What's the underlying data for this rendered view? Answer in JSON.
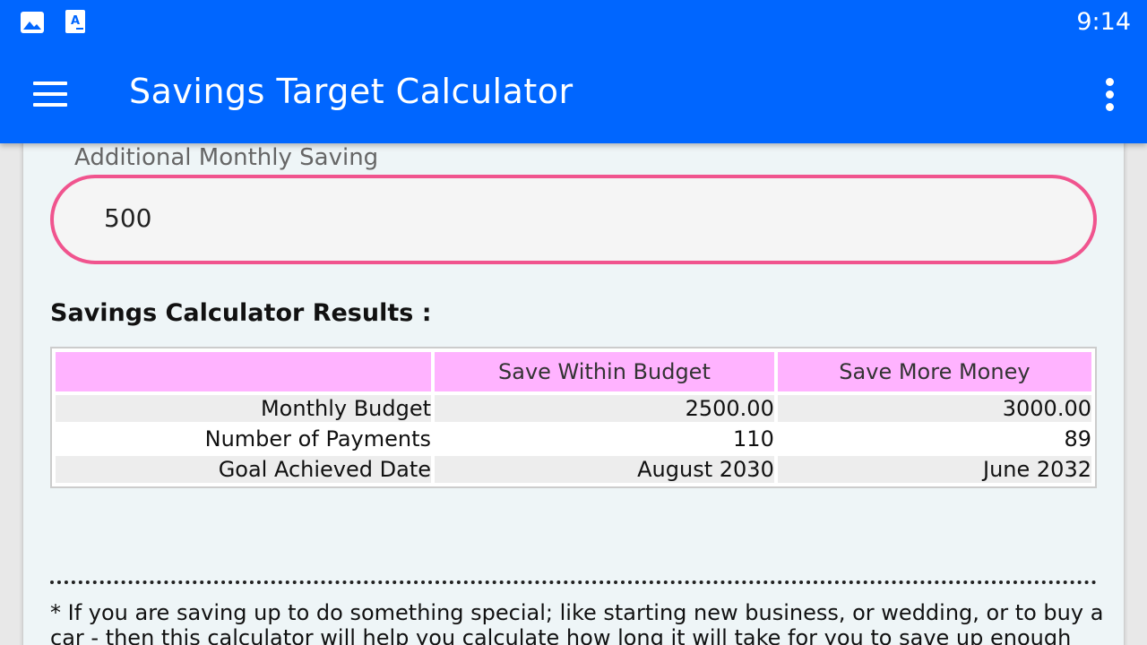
{
  "status_bar": {
    "time": "9:14",
    "icons": [
      "image-icon",
      "app-store-icon"
    ]
  },
  "toolbar": {
    "title": "Savings Target Calculator",
    "menu_icon": "hamburger-menu-icon",
    "overflow_icon": "more-vert-icon"
  },
  "form": {
    "additional_monthly_saving": {
      "label": "Additional Monthly Saving",
      "value": "500"
    }
  },
  "results": {
    "title": "Savings Calculator Results :",
    "columns": [
      "",
      "Save Within Budget",
      "Save More Money"
    ],
    "rows": [
      {
        "label": "Monthly Budget",
        "within": "2500.00",
        "more": "3000.00"
      },
      {
        "label": "Number of Payments",
        "within": "110",
        "more": "89"
      },
      {
        "label": "Goal Achieved Date",
        "within": "August 2030",
        "more": "June 2032"
      }
    ]
  },
  "note": "* If you are saving up to do something special; like starting new business, or wedding, or to buy a car - then this calculator will help you calculate how long it will take for you to save up enough money to",
  "colors": {
    "app_bar": "#0066ff",
    "field_border": "#f0548e",
    "table_header": "#ffb3ff",
    "card_background": "#eef5f7"
  }
}
